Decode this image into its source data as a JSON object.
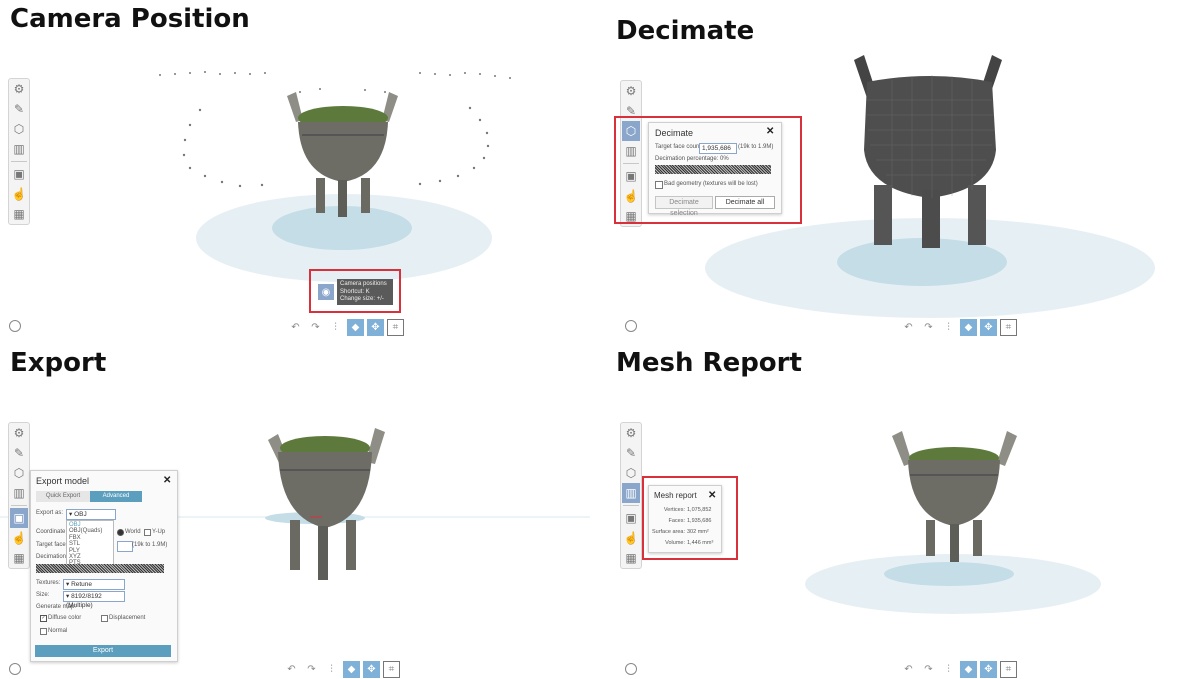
{
  "sections": {
    "camera": {
      "title": "Camera Position",
      "tooltip": {
        "line1": "Camera positions",
        "line2": "Shortcut: K",
        "line3": "Change size: +/-"
      }
    },
    "decimate": {
      "title": "Decimate",
      "dialog": {
        "title": "Decimate",
        "target_label": "Target face count:",
        "target_value": "1,935,686",
        "target_range": "(19k to 1.9M)",
        "percentage_label": "Decimation percentage: 0%",
        "checkbox_label": "Bad geometry (textures will be lost)",
        "decimate_selection": "Decimate selection",
        "decimate_all": "Decimate all"
      }
    },
    "export": {
      "title": "Export",
      "dialog": {
        "title": "Export model",
        "tab_quick": "Quick Export",
        "tab_advanced": "Advanced",
        "export_as_label": "Export as:",
        "export_as_value": "▾ OBJ",
        "format_options": [
          "OBJ",
          "OBJ(Quads)",
          "FBX",
          "STL",
          "PLY",
          "XYZ",
          "PTS"
        ],
        "coordinate_label": "Coordinate",
        "world_label": "World",
        "yup_label": "Y-Up",
        "target_face_label": "Target face",
        "target_range": "(19k to 1.9M)",
        "decimation_label": "Decimation",
        "textures_label": "Textures:",
        "textures_value": "▾ Retune",
        "size_label": "Size:",
        "size_value": "▾ 8192/8192 (Multiple)",
        "generate_map_label": "Generate map:",
        "diffuse_label": "Diffuse color",
        "displacement_label": "Displacement",
        "normal_label": "Normal",
        "export_button": "Export"
      }
    },
    "mesh_report": {
      "title": "Mesh Report",
      "dialog": {
        "title": "Mesh report",
        "rows": [
          {
            "label": "Vertices:",
            "value": "1,075,852"
          },
          {
            "label": "Faces:",
            "value": "1,935,686"
          },
          {
            "label": "Surface area:",
            "value": "302 mm²"
          },
          {
            "label": "Volume:",
            "value": "1,446 mm³"
          }
        ]
      }
    }
  },
  "colors": {
    "accent_blue": "#5b9ebd",
    "active_tool": "#8aa6cb",
    "highlight_red": "#d8313c",
    "floor_outer": "#e6f0f4",
    "floor_inner": "#c4dde6"
  }
}
